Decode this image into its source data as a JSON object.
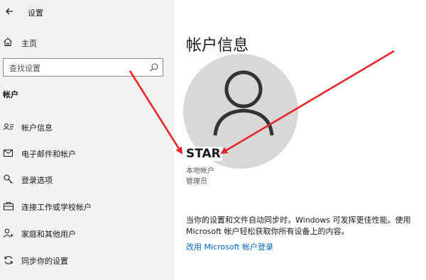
{
  "window": {
    "title": "设置"
  },
  "sidebar": {
    "home_label": "主页",
    "search_placeholder": "查找设置",
    "section_title": "帐户",
    "items": [
      {
        "label": "帐户信息",
        "icon": "account-info-icon"
      },
      {
        "label": "电子邮件和帐户",
        "icon": "mail-icon"
      },
      {
        "label": "登录选项",
        "icon": "key-icon"
      },
      {
        "label": "连接工作或学校帐户",
        "icon": "briefcase-icon"
      },
      {
        "label": "家庭和其他用户",
        "icon": "person-add-icon"
      },
      {
        "label": "同步你的设置",
        "icon": "sync-icon"
      }
    ]
  },
  "main": {
    "page_title": "帐户信息",
    "user": {
      "name": "STAR",
      "account_type": "本地帐户",
      "role": "管理员"
    },
    "info_text": "当你的设置和文件自动同步时，Windows 可发挥更佳性能。使用 Microsoft 帐户轻松获取你所有设备上的内容。",
    "link_text": "改用 Microsoft 帐户登录"
  },
  "colors": {
    "sidebar_bg": "#f2f2f2",
    "link": "#0067c0",
    "annotation_arrow": "#e8262a",
    "avatar_bg": "#d8d8d8"
  }
}
